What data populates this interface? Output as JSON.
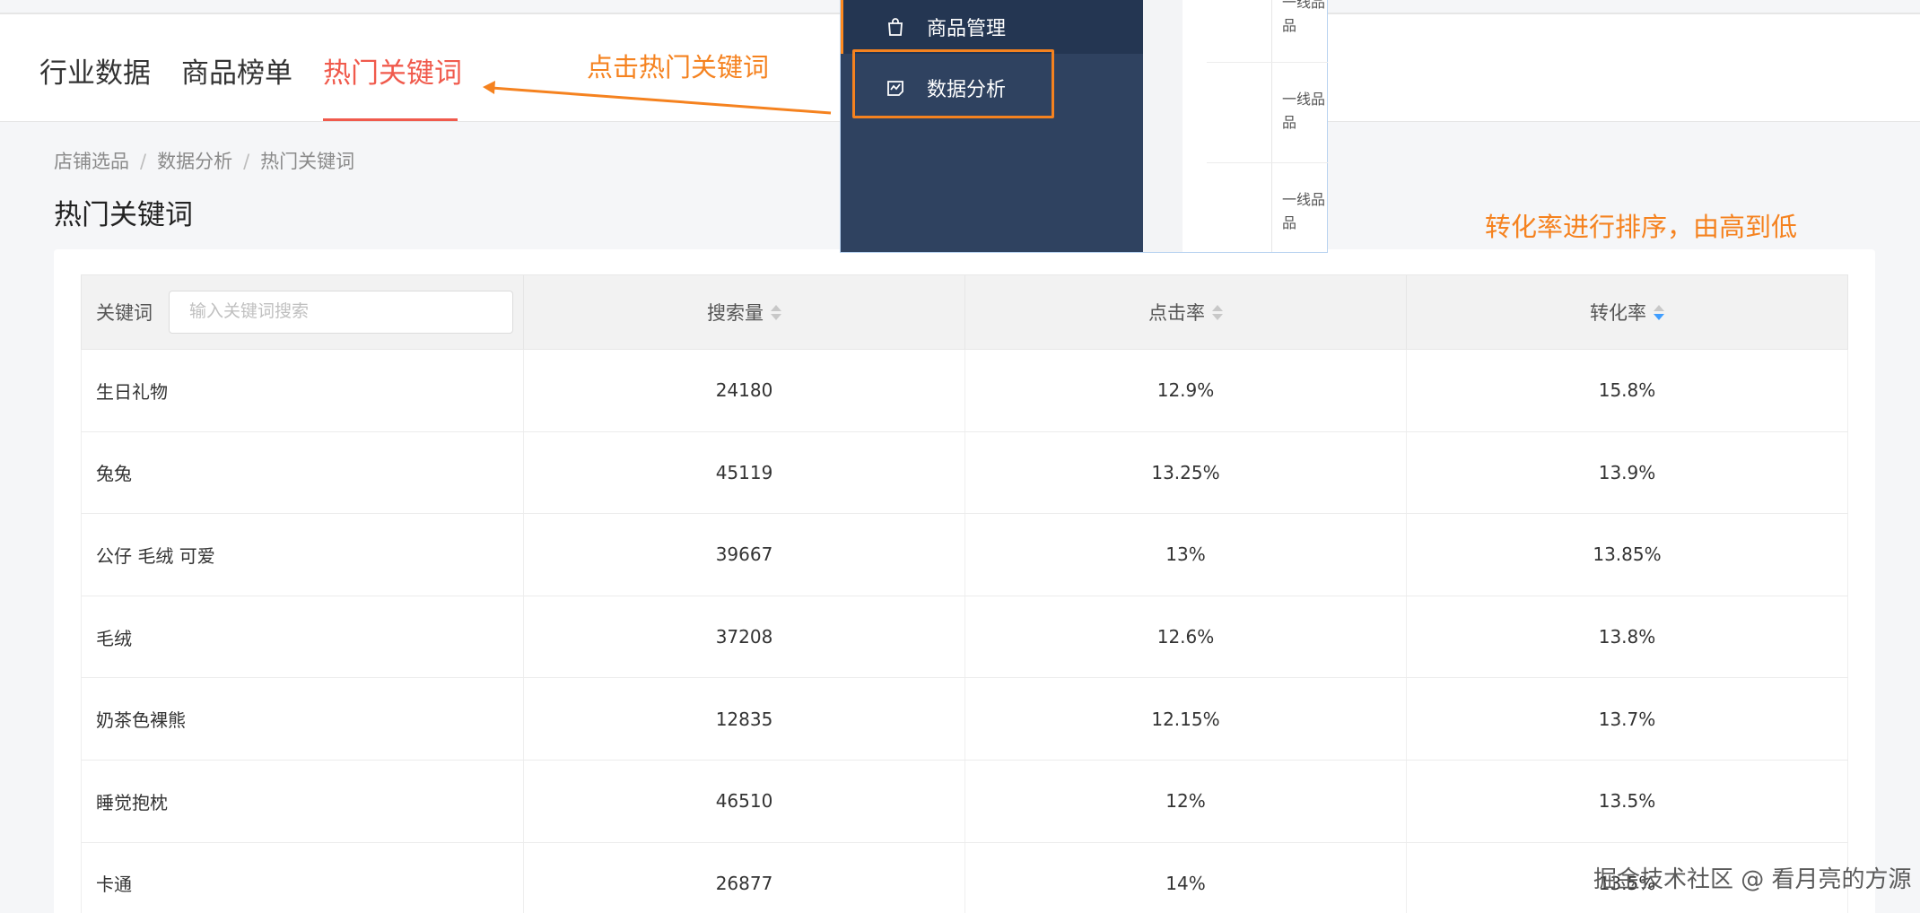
{
  "tabs": [
    {
      "label": "行业数据",
      "active": false
    },
    {
      "label": "商品榜单",
      "active": false
    },
    {
      "label": "热门关键词",
      "active": true
    }
  ],
  "annotations": {
    "click_hint": "点击热门关键词",
    "sort_hint": "转化率进行排序，由高到低"
  },
  "breadcrumb": [
    "店铺选品",
    "数据分析",
    "热门关键词"
  ],
  "page_title": "热门关键词",
  "table": {
    "keyword_header": "关键词",
    "search_placeholder": "输入关键词搜索",
    "columns": [
      "搜索量",
      "点击率",
      "转化率"
    ],
    "sorted_column": "转化率",
    "sort_order": "descending",
    "rows": [
      {
        "keyword": "生日礼物",
        "search": "24180",
        "ctr": "12.9%",
        "cvr": "15.8%"
      },
      {
        "keyword": "兔兔",
        "search": "45119",
        "ctr": "13.25%",
        "cvr": "13.9%"
      },
      {
        "keyword": "公仔 毛绒 可爱",
        "search": "39667",
        "ctr": "13%",
        "cvr": "13.85%"
      },
      {
        "keyword": "毛绒",
        "search": "37208",
        "ctr": "12.6%",
        "cvr": "13.8%"
      },
      {
        "keyword": "奶茶色裸熊",
        "search": "12835",
        "ctr": "12.15%",
        "cvr": "13.7%"
      },
      {
        "keyword": "睡觉抱枕",
        "search": "46510",
        "ctr": "12%",
        "cvr": "13.5%"
      },
      {
        "keyword": "卡通",
        "search": "26877",
        "ctr": "14%",
        "cvr": "13.5%"
      }
    ]
  },
  "popup": {
    "menu_items": [
      {
        "label": "商品管理",
        "icon": "shopping-bag-icon"
      },
      {
        "label": "数据分析",
        "icon": "chart-icon"
      }
    ],
    "side_texts": [
      "一线品品",
      "一线品品",
      "一线品品"
    ]
  },
  "watermark": "掘金技术社区 @ 看月亮的方源",
  "colors": {
    "accent": "#f05a4c",
    "annotation": "#f5821f",
    "sidebar": "#2f4260",
    "sort_active": "#409eff"
  }
}
